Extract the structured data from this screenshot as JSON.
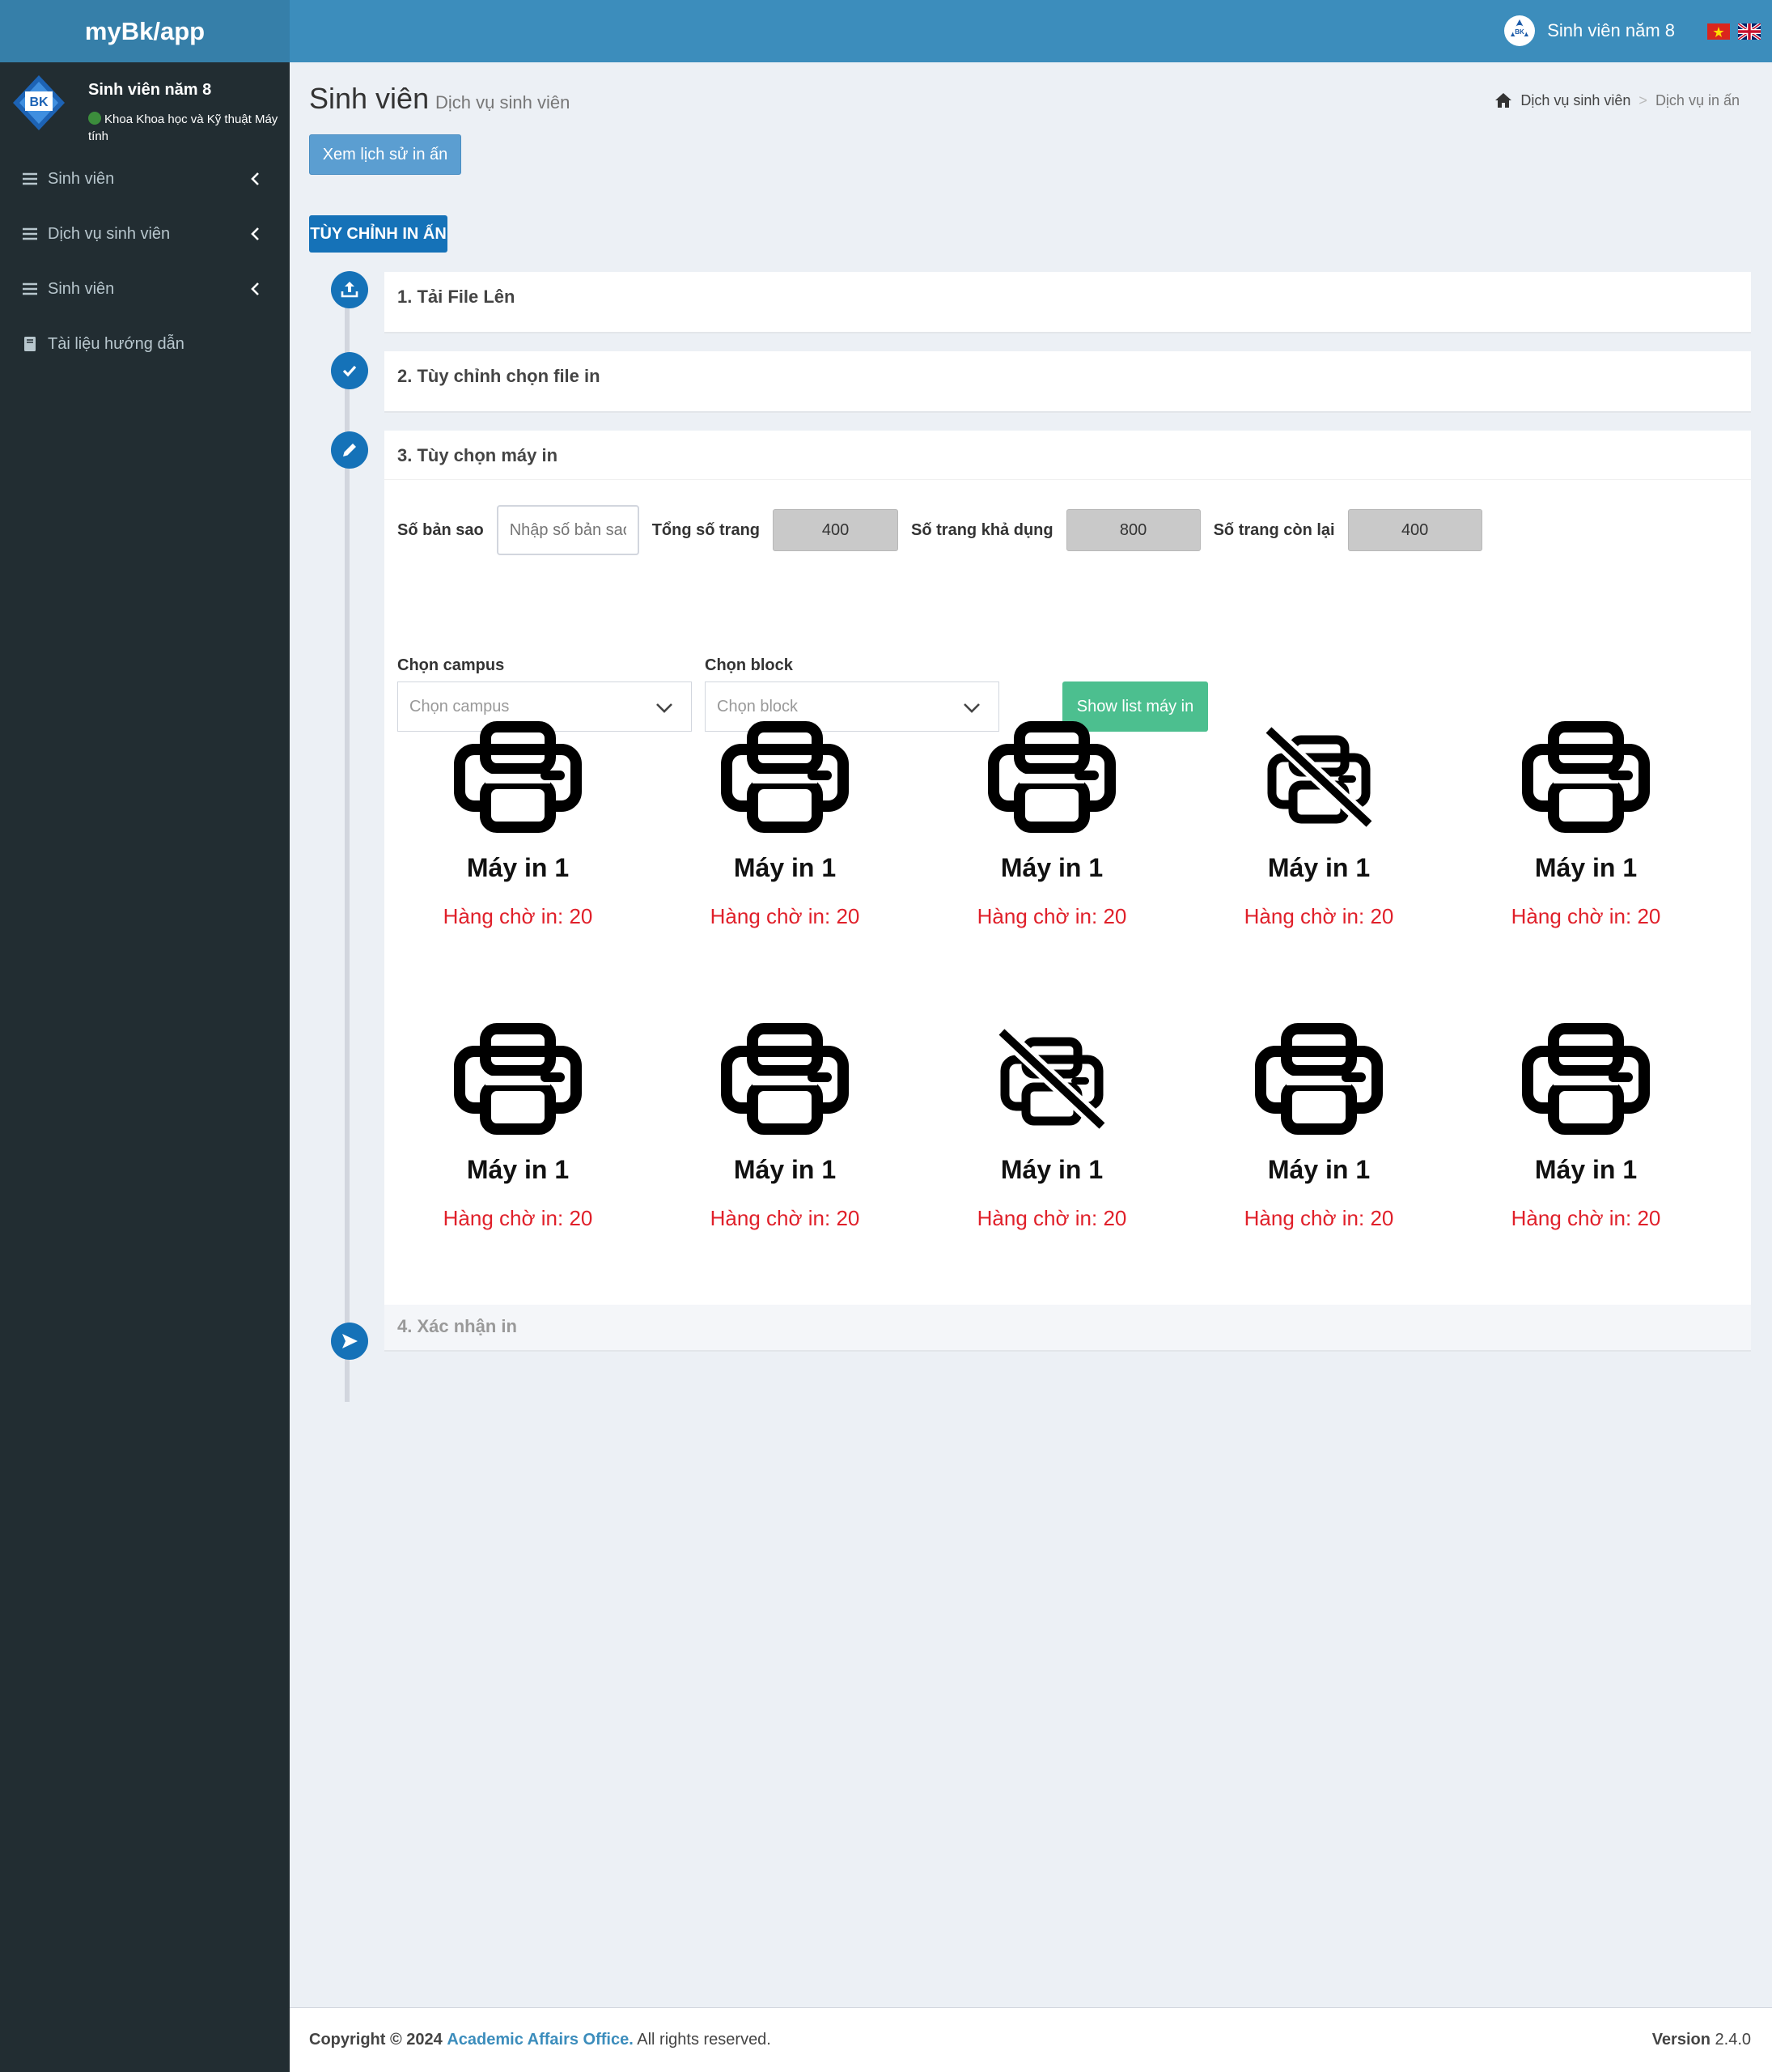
{
  "app": {
    "logo": "myBk/app"
  },
  "header": {
    "user_name": "Sinh viên năm 8",
    "flags": [
      "vietnam-flag-icon",
      "uk-flag-icon"
    ]
  },
  "sidebar": {
    "user": {
      "name": "Sinh viên năm 8",
      "department": "Khoa Khoa học và Kỹ thuật Máy tính"
    },
    "items": [
      {
        "label": "Sinh viên",
        "icon": "bars-icon"
      },
      {
        "label": "Dịch vụ sinh viên",
        "icon": "bars-icon"
      },
      {
        "label": "Sinh viên",
        "icon": "bars-icon"
      },
      {
        "label": "Tài liệu hướng dẫn",
        "icon": "book-icon"
      }
    ]
  },
  "page": {
    "title": "Sinh viên",
    "subtitle": "Dịch vụ sinh viên",
    "breadcrumb": [
      "Dịch vụ sinh viên",
      "Dịch vụ in ấn"
    ],
    "history_button": "Xem lịch sử in ấn",
    "section_tag": "TÙY CHỈNH IN ẤN"
  },
  "steps": [
    {
      "title": "1. Tải File Lên",
      "icon": "upload-icon"
    },
    {
      "title": "2. Tùy chỉnh chọn file in",
      "icon": "check-icon"
    },
    {
      "title": "3. Tùy chọn máy in",
      "icon": "pencil-icon"
    },
    {
      "title": "4. Xác nhận in",
      "icon": "send-icon"
    }
  ],
  "form": {
    "copies_label": "Số bản sao",
    "copies_placeholder": "Nhập số bản sao",
    "total_pages_label": "Tổng số trang",
    "total_pages": "400",
    "available_pages_label": "Số trang khả dụng",
    "available_pages": "800",
    "remaining_pages_label": "Số trang còn lại",
    "remaining_pages": "400",
    "campus_label": "Chọn campus",
    "campus_value": "Chọn campus",
    "block_label": "Chọn block",
    "block_value": "Chọn block",
    "show_button": "Show list máy in"
  },
  "printers": [
    {
      "name": "Máy in 1",
      "queue": "Hàng chờ in: 20",
      "available": true
    },
    {
      "name": "Máy in 1",
      "queue": "Hàng chờ in: 20",
      "available": true
    },
    {
      "name": "Máy in 1",
      "queue": "Hàng chờ in: 20",
      "available": true
    },
    {
      "name": "Máy in 1",
      "queue": "Hàng chờ in: 20",
      "available": false
    },
    {
      "name": "Máy in 1",
      "queue": "Hàng chờ in: 20",
      "available": true
    },
    {
      "name": "Máy in 1",
      "queue": "Hàng chờ in: 20",
      "available": true
    },
    {
      "name": "Máy in 1",
      "queue": "Hàng chờ in: 20",
      "available": true
    },
    {
      "name": "Máy in 1",
      "queue": "Hàng chờ in: 20",
      "available": false
    },
    {
      "name": "Máy in 1",
      "queue": "Hàng chờ in: 20",
      "available": true
    },
    {
      "name": "Máy in 1",
      "queue": "Hàng chờ in: 20",
      "available": true
    }
  ],
  "footer": {
    "copyright_prefix": "Copyright © 2024",
    "org": "Academic Affairs Office.",
    "rights": "All rights reserved.",
    "version_label": "Version",
    "version": "2.4.0"
  },
  "colors": {
    "header": "#3c8dbc",
    "sidebar": "#222d32",
    "step": "#1572b8",
    "show_button": "#4cbf8f",
    "queue_text": "#e0202a"
  }
}
